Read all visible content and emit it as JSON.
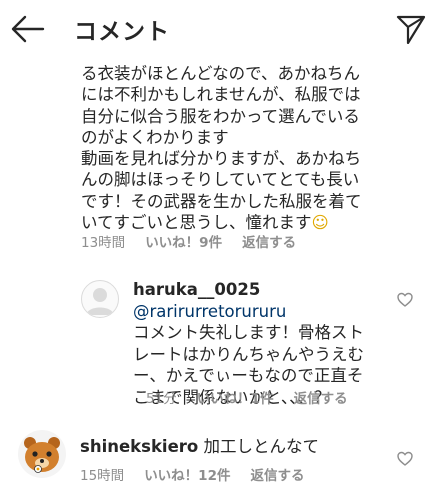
{
  "header": {
    "title": "コメント"
  },
  "comments": [
    {
      "lines": [
        "る衣装がほとんどなので、あかねちん",
        "には不利かもしれませんが、私服では",
        "自分に似合う服をわかって選んでいる",
        "のがよくわかります",
        "動画を見れば分かりますが、あかねち",
        "んの脚はほっそりしていてとても長い",
        "です！その武器を生かした私服を着て",
        "いてすごいと思うし、憧れます"
      ],
      "emoji": "☺",
      "time": "13時間",
      "likes": "いいね！9件",
      "reply": "返信する"
    },
    {
      "username": "haruka__0025",
      "mention": "@rarirurretorururu",
      "mention_display": "@rarirureto ru ru ru",
      "lines": [
        "コメント失礼します！骨格スト",
        "レートはかりんちゃんやうえむ",
        "ー、かえでぃーもなので正直そ",
        "こまで関係ないかと、、、？"
      ],
      "time": "51分",
      "likes": "いいね！1件",
      "reply": "返信する"
    },
    {
      "username": "shinekskiero",
      "text": "加工しとんなて",
      "time": "15時間",
      "likes": "いいね！12件",
      "reply": "返信する"
    }
  ]
}
